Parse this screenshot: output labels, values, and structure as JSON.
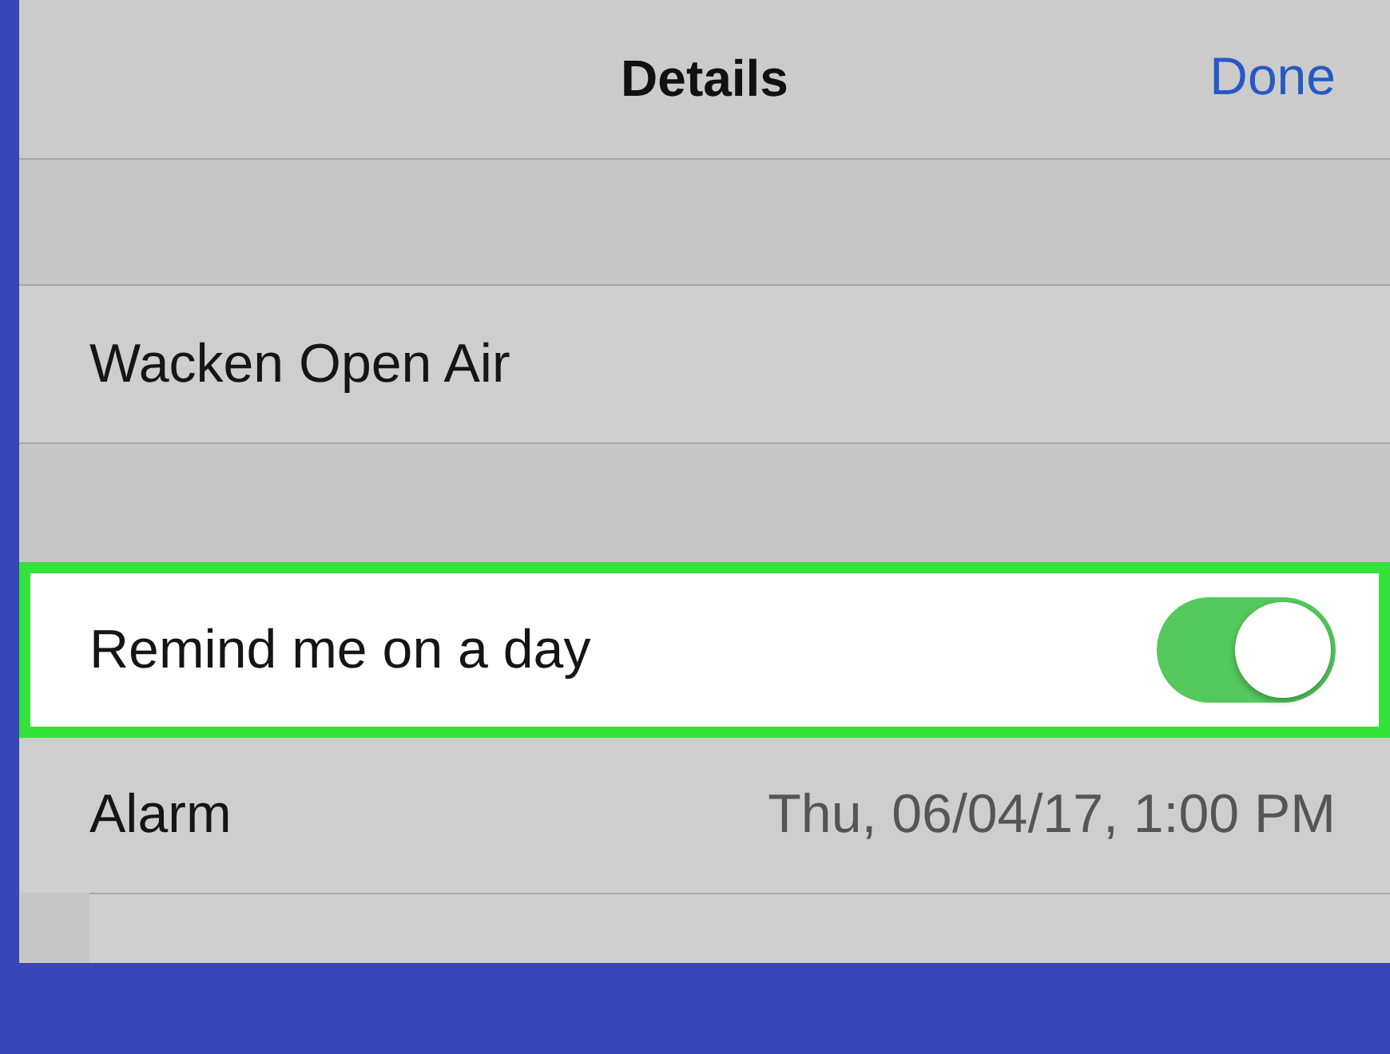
{
  "nav": {
    "title": "Details",
    "done": "Done"
  },
  "title_row": {
    "value": "Wacken Open Air"
  },
  "reminder": {
    "label": "Remind me on a day",
    "on": true,
    "highlighted": true
  },
  "alarm": {
    "label": "Alarm",
    "value": "Thu, 06/04/17, 1:00 PM"
  }
}
